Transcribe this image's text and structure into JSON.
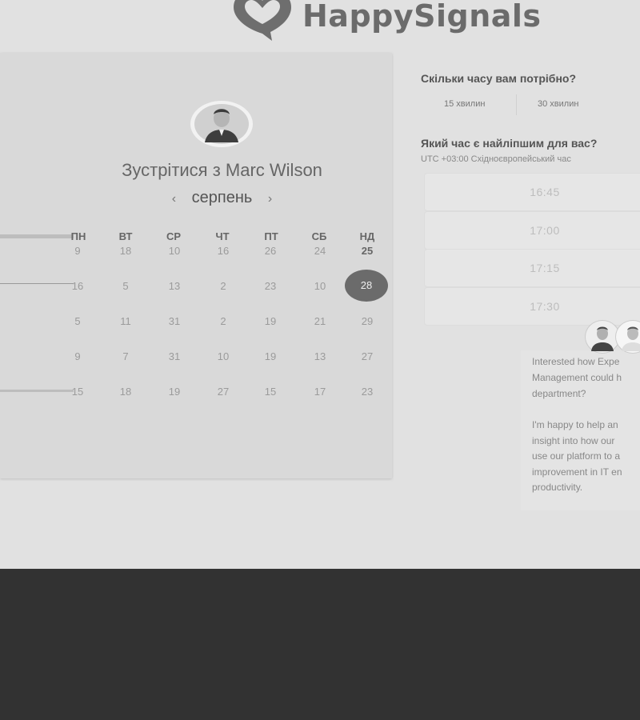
{
  "brand": {
    "name": "HappySignals"
  },
  "scheduler": {
    "title": "Зустрітися з Marc Wilson",
    "month": "серпень",
    "prev_icon": "‹",
    "next_icon": "›",
    "weekdays": [
      "ПН",
      "ВТ",
      "СР",
      "ЧТ",
      "ПТ",
      "СБ",
      "НД"
    ],
    "weeks": [
      [
        "9",
        "18",
        "10",
        "16",
        "26",
        "24",
        "25"
      ],
      [
        "16",
        "5",
        "13",
        "2",
        "23",
        "10",
        "28"
      ],
      [
        "5",
        "11",
        "31",
        "2",
        "19",
        "21",
        "29"
      ],
      [
        "9",
        "7",
        "31",
        "10",
        "19",
        "13",
        "27"
      ],
      [
        "15",
        "18",
        "19",
        "27",
        "15",
        "17",
        "23"
      ]
    ],
    "selected_day": "28"
  },
  "duration": {
    "question": "Скільки часу вам потрібно?",
    "options": [
      "15 хвилин",
      "30 хвилин"
    ]
  },
  "times": {
    "question": "Який час є найліпшим для вас?",
    "timezone": "UTC +03:00 Східноєвропейський час",
    "slots": [
      "16:45",
      "17:00",
      "17:15",
      "17:30"
    ]
  },
  "chat": {
    "message_1": [
      "Interested how Expe",
      "Management could h",
      "department?"
    ],
    "message_2": [
      "I'm happy to help an",
      "insight into how our",
      "use our platform to a",
      "improvement in IT en",
      "productivity."
    ]
  },
  "colors": {
    "background": "#e1e1e1",
    "card": "#d9d9d9",
    "selected": "#6b6b6b",
    "footer": "#323232"
  }
}
